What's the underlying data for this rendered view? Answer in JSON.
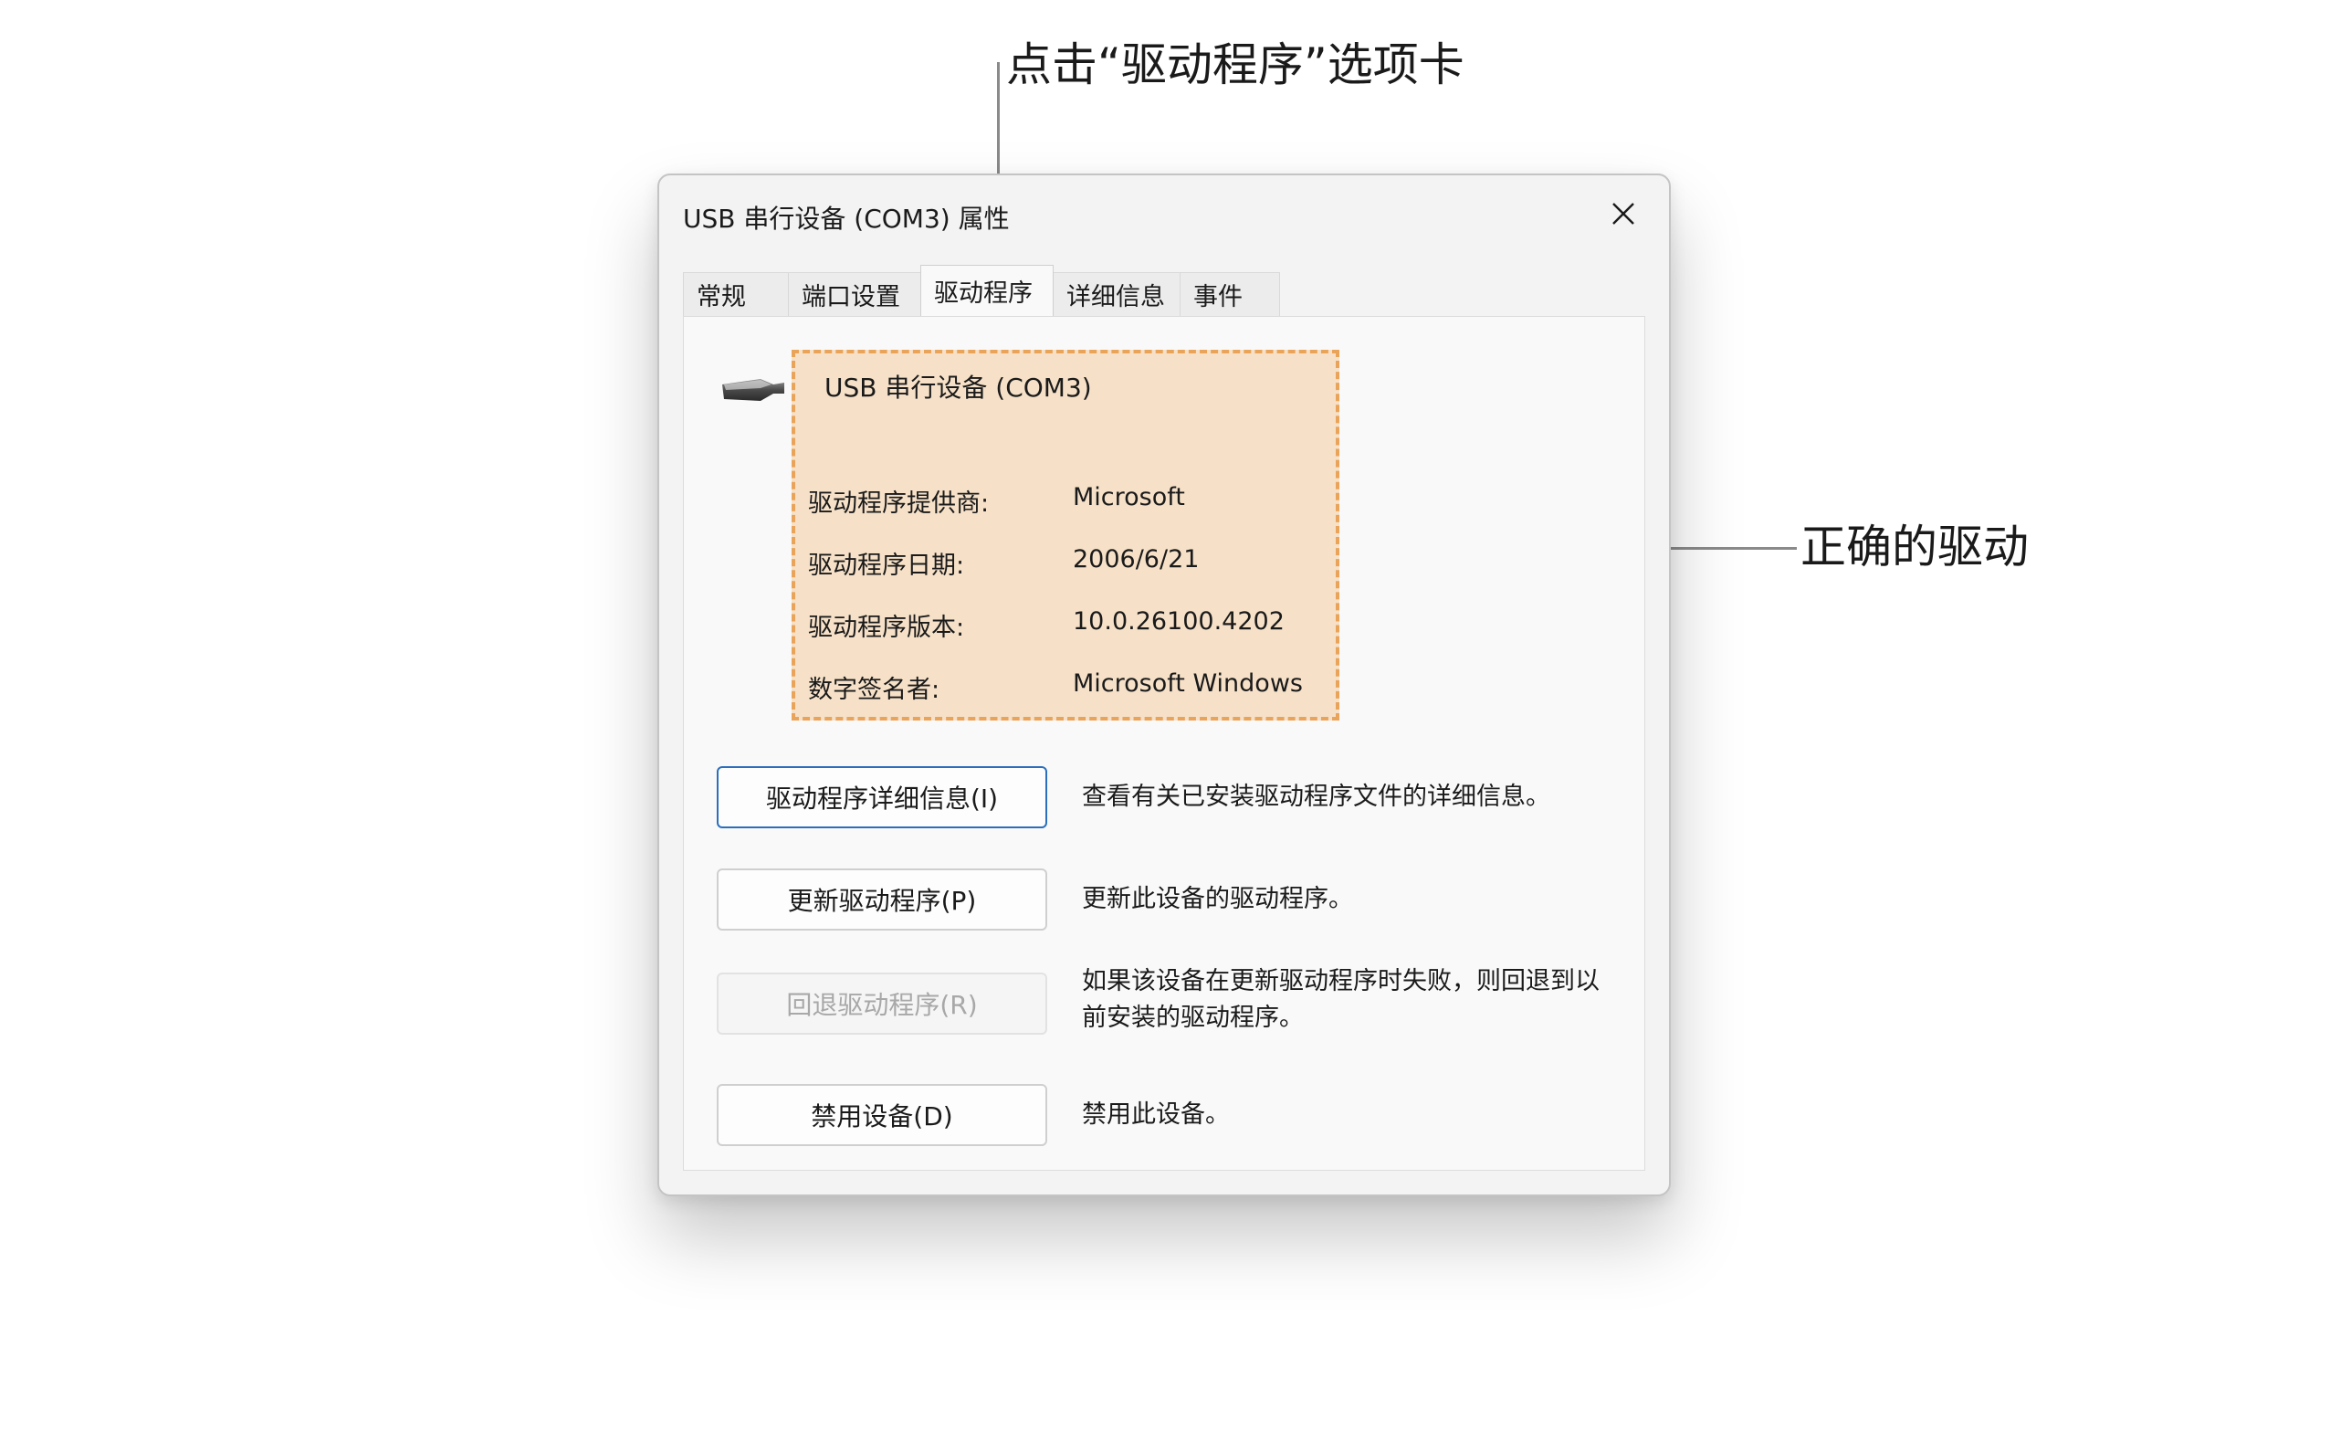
{
  "callouts": {
    "tab_hint": "点击“驱动程序”选项卡",
    "driver_hint": "正确的驱动"
  },
  "dialog": {
    "title": "USB 串行设备 (COM3) 属性",
    "close_icon": "close-icon",
    "tabs": [
      {
        "label": "常规",
        "active": false
      },
      {
        "label": "端口设置",
        "active": false
      },
      {
        "label": "驱动程序",
        "active": true
      },
      {
        "label": "详细信息",
        "active": false
      },
      {
        "label": "事件",
        "active": false
      }
    ]
  },
  "driver": {
    "device_icon": "usb-plug-icon",
    "device_name": "USB 串行设备 (COM3)",
    "rows": [
      {
        "label": "驱动程序提供商:",
        "value": "Microsoft"
      },
      {
        "label": "驱动程序日期:",
        "value": "2006/6/21"
      },
      {
        "label": "驱动程序版本:",
        "value": "10.0.26100.4202"
      },
      {
        "label": "数字签名者:",
        "value": "Microsoft Windows"
      }
    ],
    "highlight_color": "#f6e1c8",
    "highlight_border_color": "#e9a45a"
  },
  "actions": [
    {
      "button": "驱动程序详细信息(I)",
      "description": "查看有关已安装驱动程序文件的详细信息。",
      "enabled": true,
      "focused": true
    },
    {
      "button": "更新驱动程序(P)",
      "description": "更新此设备的驱动程序。",
      "enabled": true,
      "focused": false
    },
    {
      "button": "回退驱动程序(R)",
      "description": "如果该设备在更新驱动程序时失败，则回退到以前安装的驱动程序。",
      "enabled": false,
      "focused": false
    },
    {
      "button": "禁用设备(D)",
      "description": "禁用此设备。",
      "enabled": true,
      "focused": false
    }
  ],
  "colors": {
    "focus_border": "#2a6fbd",
    "dialog_background": "#f3f3f3"
  }
}
